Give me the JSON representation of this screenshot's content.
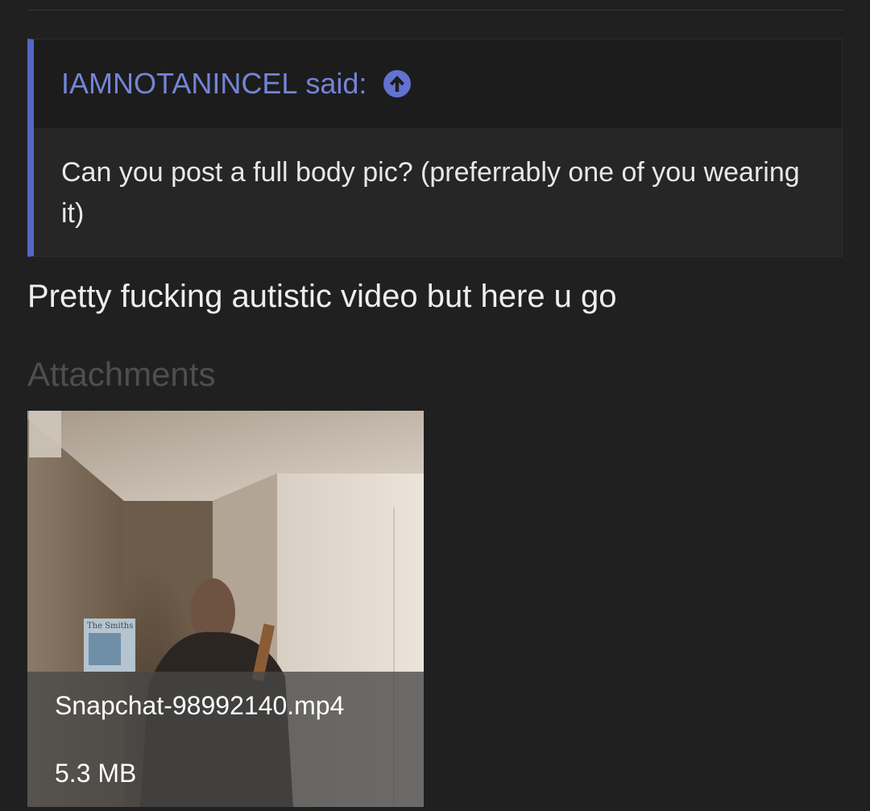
{
  "quote": {
    "author": "IAMNOTANINCEL",
    "said": "said:",
    "jump_icon": "arrow-up-circle-icon",
    "body": "Can you post a full body pic? (preferrably one of you wearing it)"
  },
  "post": {
    "message": "Pretty fucking autistic video but here u go"
  },
  "attachments": {
    "heading": "Attachments",
    "items": [
      {
        "filename": "Snapchat-98992140.mp4",
        "size": "5.3 MB",
        "poster_text": "The Smiths"
      }
    ]
  },
  "colors": {
    "background": "#202020",
    "accent": "#5566c4",
    "link": "#7484d6"
  }
}
